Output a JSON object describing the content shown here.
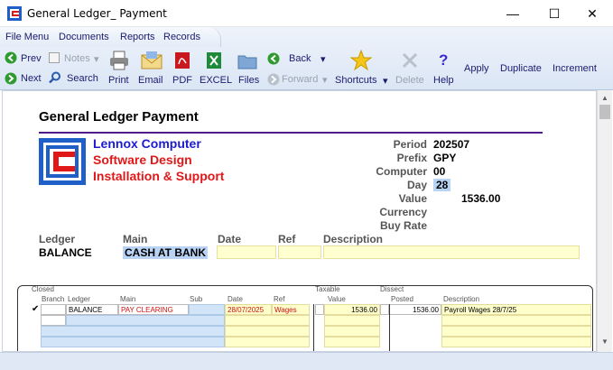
{
  "window": {
    "title": "General Ledger_ Payment",
    "minimize_glyph": "—",
    "maximize_glyph": "☐",
    "close_glyph": "✕"
  },
  "menu": [
    "File Menu",
    "Documents",
    "Reports",
    "Records"
  ],
  "toolbar": {
    "prev": "Prev",
    "notes": "Notes",
    "next": "Next",
    "search": "Search",
    "print": "Print",
    "email": "Email",
    "pdf": "PDF",
    "excel": "EXCEL",
    "files": "Files",
    "back": "Back",
    "forward": "Forward",
    "shortcuts": "Shortcuts",
    "delete": "Delete",
    "help": "Help",
    "apply": "Apply",
    "duplicate": "Duplicate",
    "increment": "Increment",
    "dropdown_glyph": "▾"
  },
  "document": {
    "title": "General Ledger Payment",
    "company": {
      "line1": "Lennox Computer",
      "line2": "Software Design",
      "line3": "Installation & Support"
    },
    "info": {
      "period_label": "Period",
      "period": "202507",
      "prefix_label": "Prefix",
      "prefix": "GPY",
      "computer_label": "Computer",
      "computer": "00",
      "day_label": "Day",
      "day": "28",
      "value_label": "Value",
      "value": "1536.00",
      "currency_label": "Currency",
      "buy_rate_label": "Buy Rate"
    },
    "header": {
      "ledger_label": "Ledger",
      "ledger": "BALANCE",
      "main_label": "Main",
      "main": "CASH AT BANK",
      "date_label": "Date",
      "ref_label": "Ref",
      "description_label": "Description"
    },
    "grid": {
      "columns": {
        "closed": "Closed",
        "branch": "Branch",
        "ledger": "Ledger",
        "main": "Main",
        "sub": "Sub",
        "date": "Date",
        "ref": "Ref",
        "taxable": "Taxable",
        "value": "Value",
        "dissect": "Dissect",
        "posted": "Posted",
        "description": "Description"
      },
      "rows": [
        {
          "check": "✔",
          "ledger": "BALANCE",
          "main": "PAY CLEARING",
          "date": "28/07/2025",
          "ref": "Wages",
          "value": "1536.00",
          "posted": "1536.00",
          "description": "Payroll Wages 28/7/25"
        }
      ]
    }
  },
  "colors": {
    "company_blue": "#1b1bd0",
    "company_red": "#e01818",
    "rule_purple": "#4b1c8a",
    "highlight_blue": "#b9d3f5",
    "field_yellow": "#ffffd0"
  }
}
